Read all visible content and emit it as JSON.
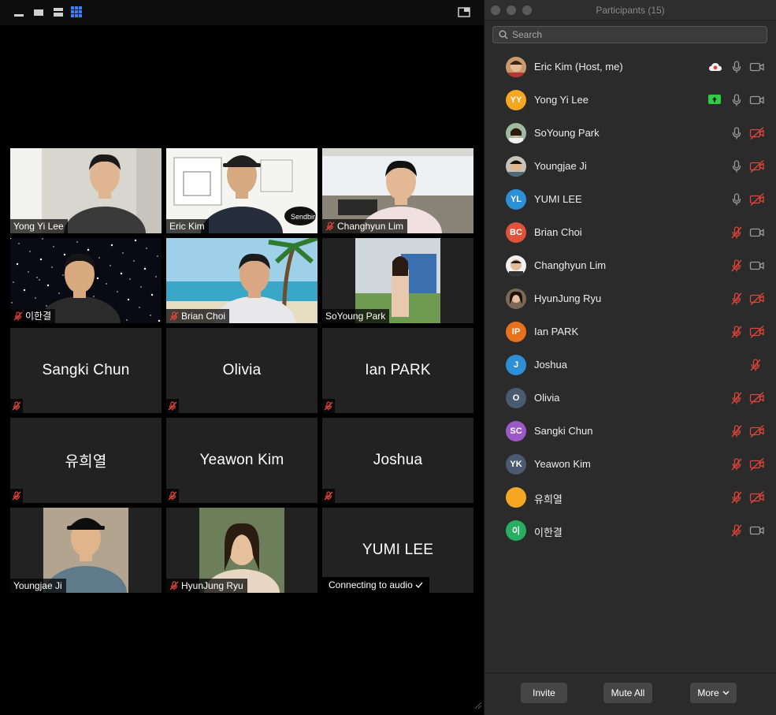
{
  "gallery": {
    "view_buttons": [
      "minimize-icon",
      "speaker-view-icon",
      "split-view-icon",
      "gallery-view-icon"
    ],
    "tiles": [
      {
        "name": "Yong Yi Lee",
        "muted": false,
        "video": true
      },
      {
        "name": "Eric Kim",
        "muted": false,
        "video": true,
        "active": true,
        "shirt_text": "Sendbird"
      },
      {
        "name": "Changhyun Lim",
        "muted": true,
        "video": true
      },
      {
        "name": "이한결",
        "muted": true,
        "video": true
      },
      {
        "name": "Brian Choi",
        "muted": true,
        "video": true
      },
      {
        "name": "SoYoung Park",
        "muted": false,
        "video": true
      },
      {
        "name": "Sangki Chun",
        "muted": true,
        "video": false
      },
      {
        "name": "Olivia",
        "muted": true,
        "video": false
      },
      {
        "name": "Ian PARK",
        "muted": true,
        "video": false
      },
      {
        "name": "유희열",
        "muted": true,
        "video": false
      },
      {
        "name": "Yeawon Kim",
        "muted": true,
        "video": false
      },
      {
        "name": "Joshua",
        "muted": true,
        "video": false
      },
      {
        "name": "Youngjae Ji",
        "muted": false,
        "video": true
      },
      {
        "name": "HyunJung Ryu",
        "muted": true,
        "video": true
      },
      {
        "name": "YUMI LEE",
        "muted": false,
        "video": false,
        "status": "Connecting to audio"
      }
    ]
  },
  "panel": {
    "title": "Participants (15)",
    "search_placeholder": "Search",
    "participants": [
      {
        "name": "Eric Kim (Host, me)",
        "avatar": "photo",
        "mic": "on",
        "cam": "on",
        "extra": "cloud-record-icon"
      },
      {
        "name": "Yong Yi Lee",
        "initials": "YY",
        "color": "#f5a623",
        "mic": "on",
        "cam": "on",
        "extra": "screen-share-icon"
      },
      {
        "name": "SoYoung Park",
        "avatar": "photo",
        "mic": "on",
        "cam": "off"
      },
      {
        "name": "Youngjae Ji",
        "avatar": "photo",
        "mic": "on",
        "cam": "off"
      },
      {
        "name": "YUMI LEE",
        "initials": "YL",
        "color": "#2d8fd5",
        "mic": "on",
        "cam": "off"
      },
      {
        "name": "Brian Choi",
        "initials": "BC",
        "color": "#e0533a",
        "mic": "off",
        "cam": "on"
      },
      {
        "name": "Changhyun Lim",
        "avatar": "photo",
        "mic": "off",
        "cam": "on"
      },
      {
        "name": "HyunJung Ryu",
        "avatar": "photo",
        "mic": "off",
        "cam": "off"
      },
      {
        "name": "Ian PARK",
        "initials": "IP",
        "color": "#e8711c",
        "mic": "off",
        "cam": "off"
      },
      {
        "name": "Joshua",
        "initials": "J",
        "color": "#2d8fd5",
        "mic": "off",
        "cam": "none"
      },
      {
        "name": "Olivia",
        "initials": "O",
        "color": "#4a5a70",
        "mic": "off",
        "cam": "off"
      },
      {
        "name": "Sangki Chun",
        "initials": "SC",
        "color": "#9b59c6",
        "mic": "off",
        "cam": "off"
      },
      {
        "name": "Yeawon Kim",
        "initials": "YK",
        "color": "#4a5a70",
        "mic": "off",
        "cam": "off"
      },
      {
        "name": "유희열",
        "initials": "",
        "color": "#f5a623",
        "mic": "off",
        "cam": "off"
      },
      {
        "name": "이한결",
        "initials": "이",
        "color": "#27ae60",
        "mic": "off",
        "cam": "on"
      }
    ],
    "footer": {
      "invite": "Invite",
      "mute_all": "Mute All",
      "more": "More"
    }
  },
  "colors": {
    "active_speaker": "#cfe86a",
    "muted_red": "#e0443a",
    "share_green": "#2ecc40",
    "record_red": "#e0443a"
  }
}
